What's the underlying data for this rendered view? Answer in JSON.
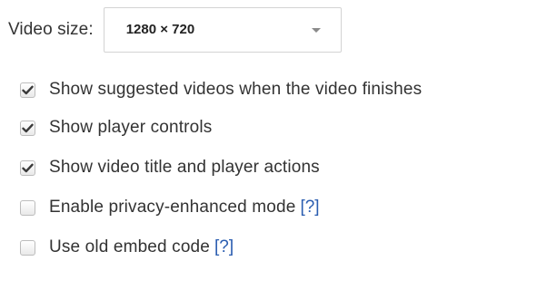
{
  "video_size": {
    "label": "Video size:",
    "selected": "1280 × 720"
  },
  "options": [
    {
      "label": "Show suggested videos when the video finishes",
      "checked": true
    },
    {
      "label": "Show player controls",
      "checked": true
    },
    {
      "label": "Show video title and player actions",
      "checked": true
    },
    {
      "label": "Enable privacy-enhanced mode",
      "checked": false,
      "help": "[?]"
    },
    {
      "label": "Use old embed code",
      "checked": false,
      "help": "[?]"
    }
  ],
  "colors": {
    "text": "#333333",
    "help_link": "#2a5db0",
    "checkbox_border": "#bcbcbc"
  }
}
